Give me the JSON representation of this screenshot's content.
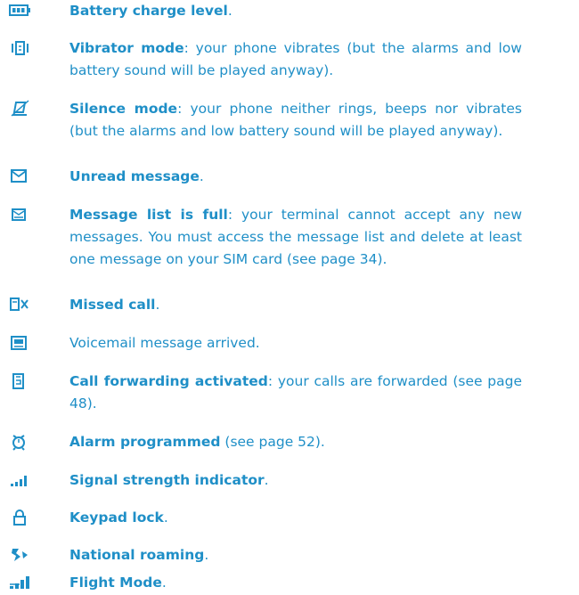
{
  "accent_color": "#1f8fc7",
  "entries": [
    {
      "icon": "battery-icon",
      "term": "Battery charge level",
      "desc": "."
    },
    {
      "icon": "vibrate-icon",
      "term": "Vibrator mode",
      "desc": ": your phone vibrates (but the alarms and low battery sound will be played anyway)."
    },
    {
      "icon": "silence-icon",
      "term": "Silence mode",
      "desc": ": your phone neither rings, beeps nor vibrates (but the alarms and low battery sound will be played anyway)."
    },
    {
      "icon": "envelope-icon",
      "term": "Unread message",
      "desc": "."
    },
    {
      "icon": "envelope-full-icon",
      "term": "Message list is full",
      "desc": ": your terminal cannot accept any new messages. You must access the message list and delete at least one message on your SIM card (see page 34)."
    },
    {
      "icon": "missed-call-icon",
      "term": "Missed call",
      "desc": "."
    },
    {
      "icon": "voicemail-icon",
      "term": "",
      "desc": "Voicemail message arrived."
    },
    {
      "icon": "call-forward-icon",
      "term": "Call forwarding activated",
      "desc": ": your calls are forwarded (see page 48)."
    },
    {
      "icon": "alarm-icon",
      "term": "Alarm programmed",
      "desc": " (see page 52)."
    },
    {
      "icon": "signal-icon",
      "term": "Signal strength indicator",
      "desc": "."
    },
    {
      "icon": "padlock-icon",
      "term": "Keypad lock",
      "desc": "."
    },
    {
      "icon": "roaming-icon",
      "term": "National roaming",
      "desc": "."
    },
    {
      "icon": "flight-mode-icon",
      "term": "Flight Mode",
      "desc": "."
    }
  ]
}
